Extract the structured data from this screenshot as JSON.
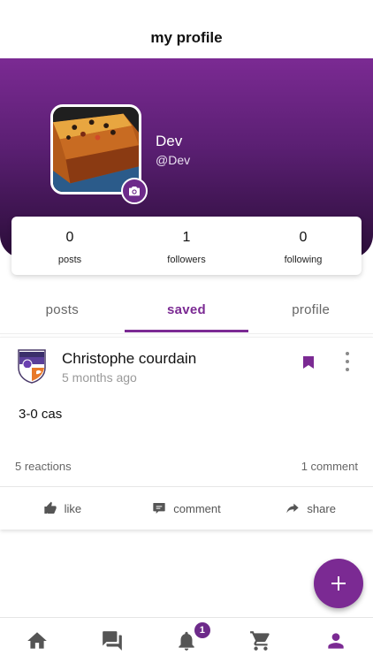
{
  "header": {
    "title": "my profile"
  },
  "profile": {
    "name": "Dev",
    "handle": "@Dev"
  },
  "stats": [
    {
      "value": "0",
      "label": "posts"
    },
    {
      "value": "1",
      "label": "followers"
    },
    {
      "value": "0",
      "label": "following"
    }
  ],
  "tabs": [
    {
      "label": "posts",
      "active": false
    },
    {
      "label": "saved",
      "active": true
    },
    {
      "label": "profile",
      "active": false
    }
  ],
  "post": {
    "author": "Christophe courdain",
    "time": "5 months ago",
    "text": "3-0 cas",
    "reactions": "5 reactions",
    "comments": "1 comment",
    "actions": {
      "like": "like",
      "comment": "comment",
      "share": "share"
    }
  },
  "bottom_nav": {
    "items": [
      "home-icon",
      "chat-icon",
      "bell-icon",
      "cart-icon",
      "person-icon"
    ],
    "notification_badge": "1"
  },
  "colors": {
    "accent": "#7b2a93",
    "hero_top": "#7b2a93",
    "hero_bottom": "#2a0d38"
  }
}
